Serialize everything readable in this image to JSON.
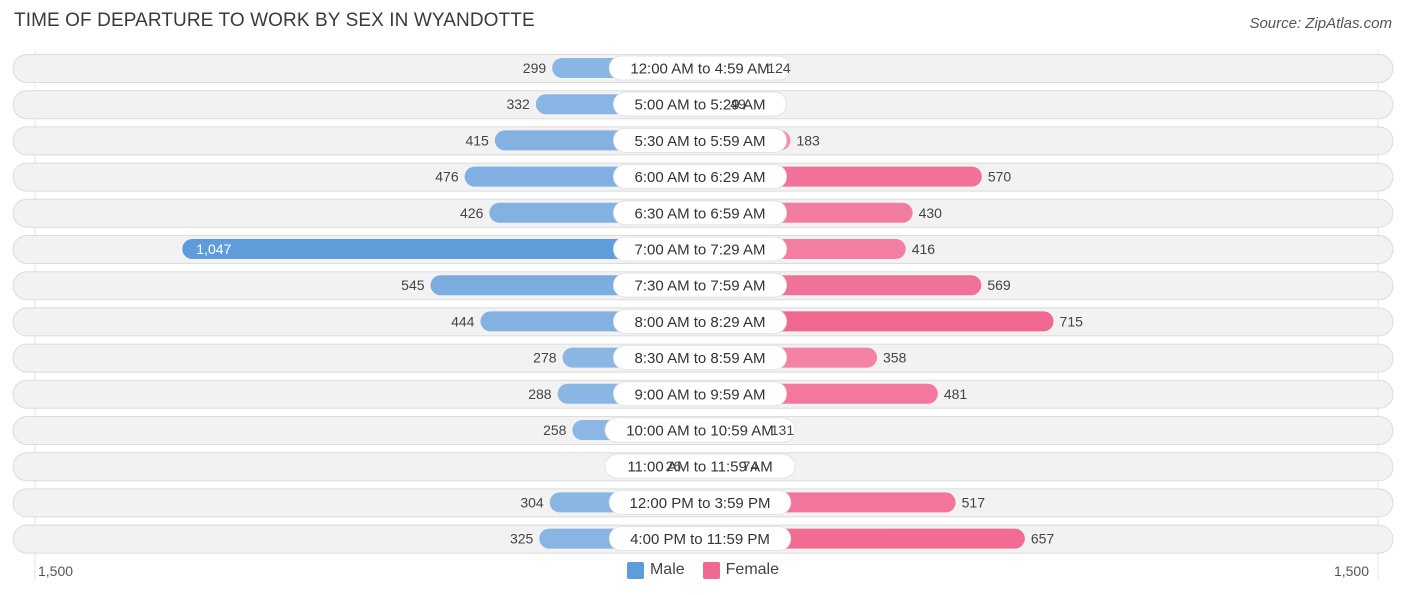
{
  "header": {
    "title": "TIME OF DEPARTURE TO WORK BY SEX IN WYANDOTTE",
    "source": "Source: ZipAtlas.com"
  },
  "legend": {
    "male_label": "Male",
    "female_label": "Female"
  },
  "axis": {
    "left_label": "1,500",
    "right_label": "1,500"
  },
  "colors": {
    "male": "#8fb8e3",
    "male_strong": "#5f9cdb",
    "female": "#f589a9",
    "female_strong": "#f06790",
    "row_bg": "#f2f2f2",
    "row_border": "#dcdcdc"
  },
  "chart_data": {
    "type": "bar",
    "orientation": "horizontal-diverging",
    "title": "TIME OF DEPARTURE TO WORK BY SEX IN WYANDOTTE",
    "xlim": [
      -1500,
      1500
    ],
    "grid": false,
    "legend_position": "bottom-center",
    "categories": [
      "12:00 AM to 4:59 AM",
      "5:00 AM to 5:29 AM",
      "5:30 AM to 5:59 AM",
      "6:00 AM to 6:29 AM",
      "6:30 AM to 6:59 AM",
      "7:00 AM to 7:29 AM",
      "7:30 AM to 7:59 AM",
      "8:00 AM to 8:29 AM",
      "8:30 AM to 8:59 AM",
      "9:00 AM to 9:59 AM",
      "10:00 AM to 10:59 AM",
      "11:00 AM to 11:59 AM",
      "12:00 PM to 3:59 PM",
      "4:00 PM to 11:59 PM"
    ],
    "series": [
      {
        "name": "Male",
        "values": [
          299,
          332,
          415,
          476,
          426,
          1047,
          545,
          444,
          278,
          288,
          258,
          26,
          304,
          325
        ],
        "labels": [
          "299",
          "332",
          "415",
          "476",
          "426",
          "1,047",
          "545",
          "444",
          "278",
          "288",
          "258",
          "26",
          "304",
          "325"
        ]
      },
      {
        "name": "Female",
        "values": [
          124,
          49,
          183,
          570,
          430,
          416,
          569,
          715,
          358,
          481,
          131,
          74,
          517,
          657
        ],
        "labels": [
          "124",
          "49",
          "183",
          "570",
          "430",
          "416",
          "569",
          "715",
          "358",
          "481",
          "131",
          "74",
          "517",
          "657"
        ]
      }
    ]
  }
}
